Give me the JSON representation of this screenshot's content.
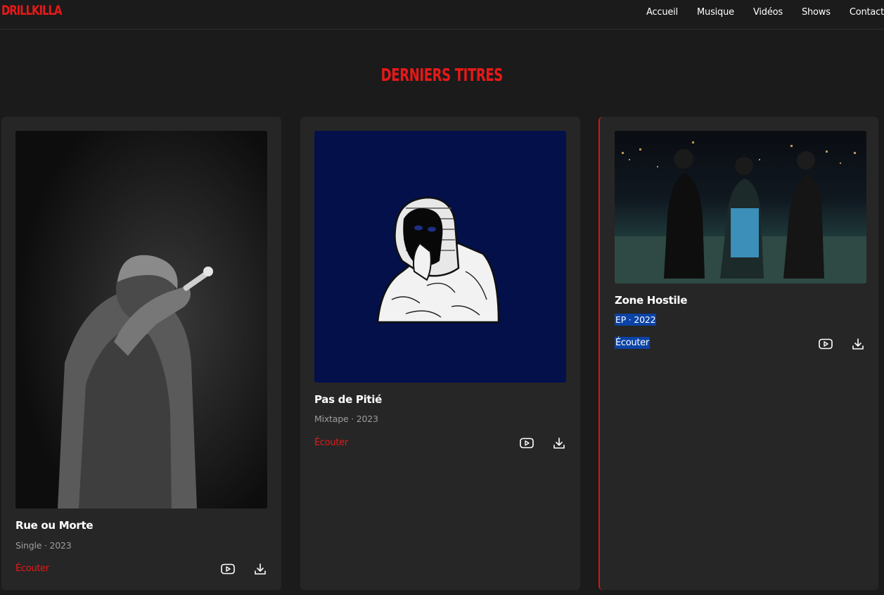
{
  "header": {
    "logo": "DRILLKILLA",
    "nav": [
      "Accueil",
      "Musique",
      "Vidéos",
      "Shows",
      "Contact"
    ]
  },
  "section": {
    "title": "DERNIERS TITRES"
  },
  "releases": [
    {
      "title": "Rue ou Morte",
      "meta": "Single · 2023",
      "listen": "Écouter"
    },
    {
      "title": "Pas de Pitié",
      "meta": "Mixtape · 2023",
      "listen": "Écouter"
    },
    {
      "title": "Zone Hostile",
      "meta": "EP · 2022",
      "listen": "Écouter"
    }
  ],
  "colors": {
    "accent": "#e81818",
    "background": "#1b1b1b",
    "card": "#262626",
    "selection": "#0b43a6"
  },
  "icons": [
    "youtube-icon",
    "download-icon"
  ]
}
